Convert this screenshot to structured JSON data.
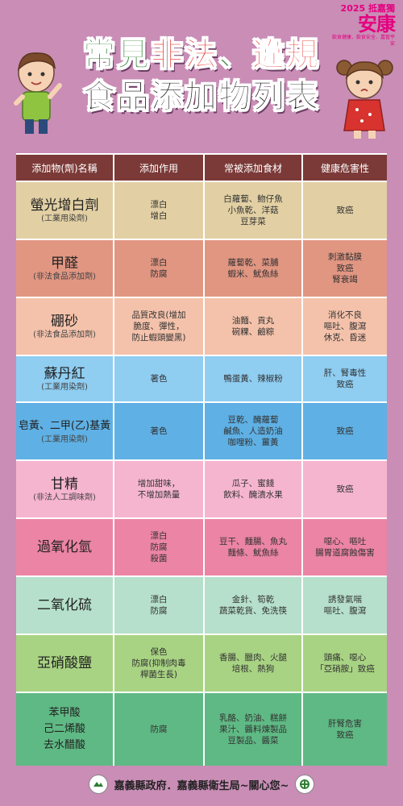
{
  "brand": {
    "year": "2025 抵嘉獨",
    "name": "安康",
    "tagline": "飲食健康．飲食安全．嘉管平安"
  },
  "title": {
    "line1_a": "常見",
    "line1_b": "非法",
    "line1_c": "、",
    "line1_d": "違規",
    "line2": "食品添加物列表"
  },
  "table": {
    "headers": [
      "添加物(劑)名稱",
      "添加作用",
      "常被添加食材",
      "健康危害性"
    ],
    "rows": [
      {
        "name": "螢光增白劑",
        "sub": "(工業用染劑)",
        "effect": [
          "漂白",
          "增白"
        ],
        "foods": [
          "白蘿蔔、魩仔魚",
          "小魚乾、洋菇",
          "豆芽菜"
        ],
        "harm": [
          "致癌"
        ],
        "color": "#e2d0a4"
      },
      {
        "name": "甲醛",
        "sub": "(非法食品添加劑)",
        "effect": [
          "漂白",
          "防腐"
        ],
        "foods": [
          "蘿蔔乾、菜脯",
          "蝦米、魷魚絲"
        ],
        "harm": [
          "刺激黏膜",
          "致癌",
          "腎衰竭"
        ],
        "color": "#e19682"
      },
      {
        "name": "硼砂",
        "sub": "(非法食品添加劑)",
        "effect": [
          "品質改良(增加",
          "脆度、彈性，",
          "防止蝦頭變黑)"
        ],
        "foods": [
          "油麵、貢丸",
          "碗粿、鹼粽"
        ],
        "harm": [
          "消化不良",
          "嘔吐、腹瀉",
          "休克、昏迷"
        ],
        "color": "#f4c2ab"
      },
      {
        "name": "蘇丹紅",
        "sub": "(工業用染劑)",
        "effect": [
          "著色"
        ],
        "foods": [
          "鴨蛋黃、辣椒粉"
        ],
        "harm": [
          "肝、腎毒性",
          "致癌"
        ],
        "color": "#8fcdf1"
      },
      {
        "name": "皂黃、二甲(乙)基黃",
        "sub": "(工業用染劑)",
        "effect": [
          "著色"
        ],
        "foods": [
          "豆乾、醃蘿蔔",
          "鹹魚、人造奶油",
          "咖哩粉、薑黃"
        ],
        "harm": [
          "致癌"
        ],
        "color": "#5fb0e4"
      },
      {
        "name": "甘精",
        "sub": "(非法人工調味劑)",
        "effect": [
          "增加甜味，",
          "不增加熱量"
        ],
        "foods": [
          "瓜子、蜜餞",
          "飲料、醃漬水果"
        ],
        "harm": [
          "致癌"
        ],
        "color": "#f6b5cf"
      },
      {
        "name": "過氧化氫",
        "sub": "",
        "effect": [
          "漂白",
          "防腐",
          "殺菌"
        ],
        "foods": [
          "豆干、麵腸、魚丸",
          "麵條、魷魚絲"
        ],
        "harm": [
          "噁心、嘔吐",
          "腸胃道腐蝕傷害"
        ],
        "color": "#eb84a5"
      },
      {
        "name": "二氧化硫",
        "sub": "",
        "effect": [
          "漂白",
          "防腐"
        ],
        "foods": [
          "金針、筍乾",
          "蔬菜乾貨、免洗筷"
        ],
        "harm": [
          "誘發氣喘",
          "嘔吐、腹瀉"
        ],
        "color": "#b6e0cb"
      },
      {
        "name": "亞硝酸鹽",
        "sub": "",
        "effect": [
          "保色",
          "防腐(抑制肉毒",
          "桿菌生長)"
        ],
        "foods": [
          "香腸、臘肉、火腿",
          "培根、熱狗"
        ],
        "harm": [
          "頭痛、噁心",
          "「亞硝胺」致癌"
        ],
        "color": "#a8d383"
      },
      {
        "name": "苯甲酸\n己二烯酸\n去水醋酸",
        "sub": "",
        "effect": [
          "防腐"
        ],
        "foods": [
          "乳酪、奶油、糕餅",
          "果汁、醬料煉製品",
          "豆製品、醬菜"
        ],
        "harm": [
          "肝腎危害",
          "致癌"
        ],
        "color": "#5fb984"
      }
    ]
  },
  "footer": {
    "text": "嘉義縣政府．嘉義縣衛生局~關心您~"
  },
  "colors": {
    "background": "#c98db6",
    "header": "#7b3a37",
    "title_green": "#2e7d32",
    "title_red": "#e53935"
  }
}
